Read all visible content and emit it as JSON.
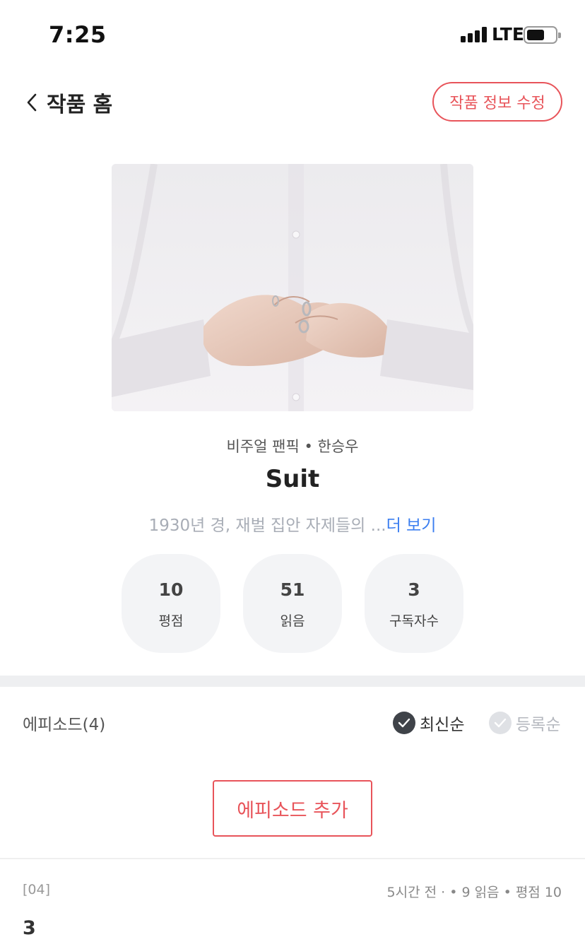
{
  "status_bar": {
    "time": "7:25",
    "network": "LTE"
  },
  "header": {
    "back_label": "작품 홈",
    "edit_label": "작품 정보 수정"
  },
  "work": {
    "meta": "비주얼 팬픽 • 한승우",
    "title": "Suit",
    "description": "1930년 경, 재벌 집안 자제들의",
    "ellipsis": "...",
    "more_label": "더 보기"
  },
  "stats": [
    {
      "value": "10",
      "label": "평점"
    },
    {
      "value": "51",
      "label": "읽음"
    },
    {
      "value": "3",
      "label": "구독자수"
    }
  ],
  "episodes": {
    "heading": "에피소드(4)",
    "sort_options": [
      {
        "label": "최신순",
        "active": true
      },
      {
        "label": "등록순",
        "active": false
      }
    ],
    "add_label": "에피소드 추가",
    "items": [
      {
        "number": "[04]",
        "info": "5시간 전 · • 9 읽음 • 평점 10",
        "title": "3"
      }
    ]
  },
  "colors": {
    "accent": "#e8545a",
    "link": "#3b7ef0",
    "stat_bg": "#f3f4f6"
  },
  "icons": {
    "back": "chevron-left-icon",
    "sort_check": "check-circle-icon"
  }
}
